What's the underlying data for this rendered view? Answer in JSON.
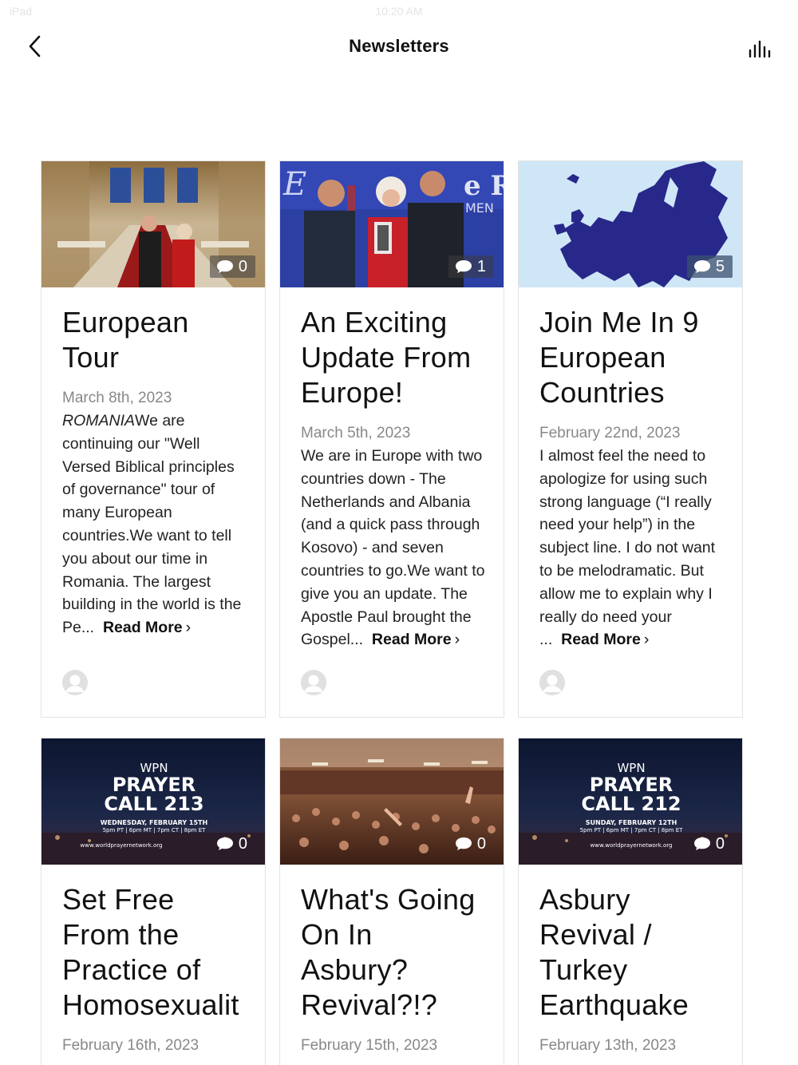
{
  "status_bar": {
    "left": "iPad",
    "time": "10:20 AM"
  },
  "header": {
    "title": "Newsletters",
    "back_icon": "chevron-left-icon",
    "action_icon": "audio-bars-icon"
  },
  "posts": [
    {
      "title": "European Tour",
      "title_lines": [
        "European",
        "Tour"
      ],
      "date": "March 8th, 2023",
      "excerpt_lead": "ROMANIA",
      "excerpt": "We are continuing our \"Well Versed Biblical principles of governance\" tour of many European countries.We want to tell you about our time in Romania. The largest building in the world is the Pe...",
      "read_more": "Read More",
      "comments": "0"
    },
    {
      "title": "An Exciting Update From Europe!",
      "title_lines": [
        "An Exciting",
        "Update From",
        "Europe!"
      ],
      "date": "March 5th, 2023",
      "excerpt": "We are in Europe with two countries down - The Netherlands and Albania (and a quick pass through Kosovo) - and seven countries to go.We want to give you an update. The Apostle Paul brought the Gospel...",
      "read_more": "Read More",
      "comments": "1"
    },
    {
      "title": "Join Me In 9 European Countries",
      "title_lines": [
        "Join Me In 9",
        "European",
        "Countries"
      ],
      "date": "February 22nd, 2023",
      "excerpt": "I almost feel the need to apologize for using such strong language (“I really need your help”) in the subject line. I do not want to be melodramatic. But allow me to explain why I really do need your ...",
      "read_more": "Read More",
      "comments": "5"
    },
    {
      "title": "Set Free From the Practice of Homosexuality",
      "title_lines": [
        "Set Free",
        "From the",
        "Practice of",
        "Homosexualit"
      ],
      "date": "February 16th, 2023",
      "comments": "0",
      "image_text": {
        "brand": "WPN",
        "line1": "PRAYER",
        "line2": "CALL 213",
        "when": "WEDNESDAY, FEBRUARY 15TH",
        "times": "5pm PT | 6pm MT | 7pm CT | 8pm ET",
        "url": "www.worldprayernetwork.org"
      }
    },
    {
      "title": "What's Going On In Asbury? Revival?!?",
      "title_lines": [
        "What's Going",
        "On In",
        "Asbury?",
        "Revival?!?"
      ],
      "date": "February 15th, 2023",
      "comments": "0"
    },
    {
      "title": "Asbury Revival / Turkey Earthquake",
      "title_lines": [
        "Asbury",
        "Revival /",
        "Turkey",
        "Earthquake"
      ],
      "date": "February 13th, 2023",
      "comments": "0",
      "image_text": {
        "brand": "WPN",
        "line1": "PRAYER",
        "line2": "CALL 212",
        "when": "SUNDAY, FEBRUARY 12TH",
        "times": "5pm PT | 6pm MT | 7pm CT | 8pm ET",
        "url": "www.worldprayernetwork.org"
      }
    }
  ],
  "colors": {
    "text": "#111111",
    "muted": "#888888",
    "border": "#e3e3e3",
    "europe_map": "#27288a",
    "map_sea": "#cfe6f7"
  }
}
